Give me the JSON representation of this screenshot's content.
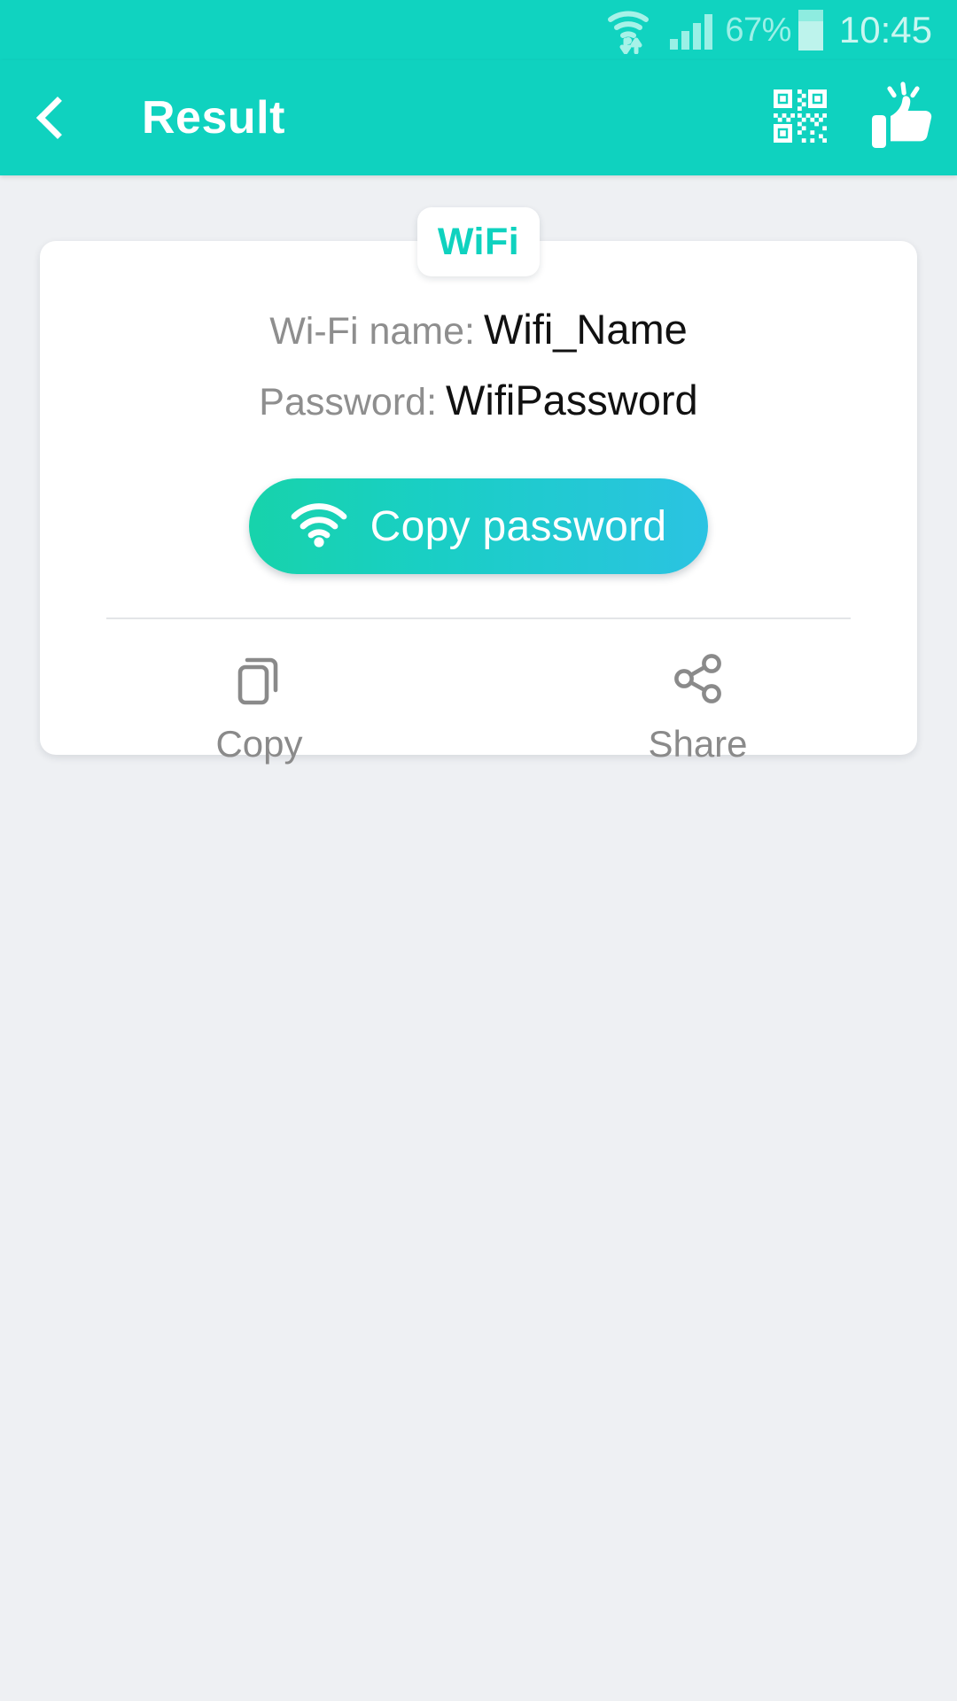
{
  "status_bar": {
    "wifi_icon": "wifi-signal-icon",
    "cellular_icon": "cellular-signal-icon",
    "battery_percent": "67%",
    "battery_icon": "battery-icon",
    "clock": "10:45"
  },
  "app_bar": {
    "back_icon": "back-chevron-icon",
    "title": "Result",
    "qr_icon": "qr-code-icon",
    "thumbs_up_icon": "thumbs-up-icon"
  },
  "card": {
    "badge_label": "WiFi",
    "rows": [
      {
        "label": "Wi-Fi name:",
        "value": "Wifi_Name"
      },
      {
        "label": "Password:",
        "value": "WifiPassword"
      }
    ],
    "primary_button": {
      "label": "Copy password",
      "icon": "wifi-icon"
    },
    "actions": [
      {
        "label": "Copy",
        "icon": "copy-icon"
      },
      {
        "label": "Share",
        "icon": "share-icon"
      }
    ]
  },
  "colors": {
    "accent": "#0fd2bf",
    "status_bar": "#10d3c0",
    "page_background": "#eef0f3",
    "card_background": "#ffffff",
    "label_text": "#8e8e8e",
    "value_text": "#111111",
    "button_gradient_start": "#17d3ab",
    "button_gradient_end": "#2bc3e2"
  }
}
